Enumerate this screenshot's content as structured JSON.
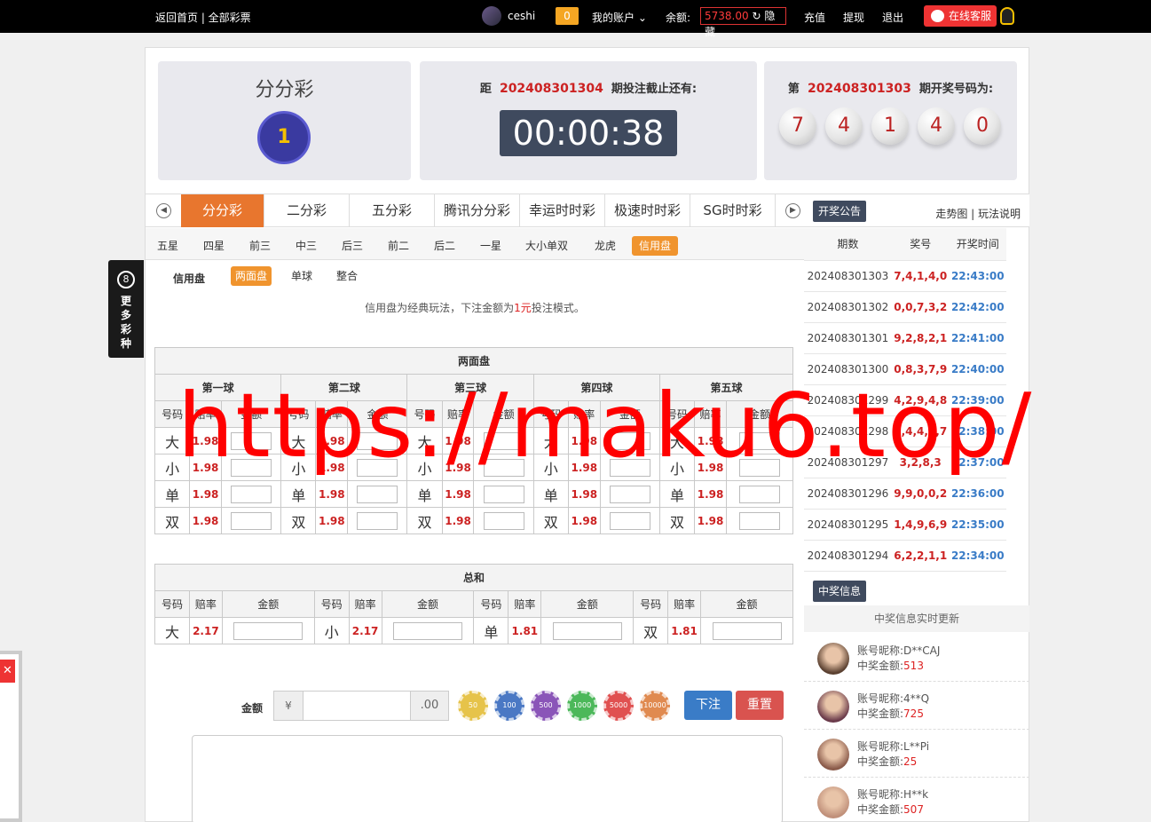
{
  "topbar": {
    "home_links": "返回首页 | 全部彩票",
    "username": "ceshi",
    "message_count": "0",
    "account_menu": "我的账户",
    "balance_label": "余额:",
    "balance_value": "5738.00",
    "balance_hide": "隐藏",
    "recharge": "充值",
    "withdraw": "提现",
    "logout": "退出",
    "service": "在线客服"
  },
  "game": {
    "title": "分分彩",
    "logo_text": "1"
  },
  "countdown": {
    "prefix": "距",
    "issue": "202408301304",
    "suffix": "期投注截止还有:",
    "time": "00:00:38"
  },
  "result": {
    "prefix": "第",
    "issue": "202408301303",
    "suffix": "期开奖号码为:",
    "balls": [
      "7",
      "4",
      "1",
      "4",
      "0"
    ]
  },
  "lottery_tabs": [
    "分分彩",
    "二分彩",
    "五分彩",
    "腾讯分分彩",
    "幸运时时彩",
    "极速时时彩",
    "SG时时彩"
  ],
  "play_tabs": [
    "五星",
    "四星",
    "前三",
    "中三",
    "后三",
    "前二",
    "后二",
    "一星",
    "大小单双",
    "龙虎",
    "信用盘"
  ],
  "mode": {
    "label": "信用盘",
    "options": [
      "两面盘",
      "单球",
      "整合"
    ],
    "description_pre": "信用盘为经典玩法，下注金额为",
    "description_red": "1元",
    "description_post": "投注模式。"
  },
  "two_sides": {
    "title": "两面盘",
    "balls": [
      "第一球",
      "第二球",
      "第三球",
      "第四球",
      "第五球"
    ],
    "headers": [
      "号码",
      "赔率",
      "金额"
    ],
    "rows": [
      {
        "code": "大",
        "odds": "1.98"
      },
      {
        "code": "小",
        "odds": "1.98"
      },
      {
        "code": "单",
        "odds": "1.98"
      },
      {
        "code": "双",
        "odds": "1.98"
      }
    ]
  },
  "sum": {
    "title": "总和",
    "headers": [
      "号码",
      "赔率",
      "金额"
    ],
    "items": [
      {
        "code": "大",
        "odds": "2.17"
      },
      {
        "code": "小",
        "odds": "2.17"
      },
      {
        "code": "单",
        "odds": "1.81"
      },
      {
        "code": "双",
        "odds": "1.81"
      }
    ]
  },
  "amount": {
    "label": "金额",
    "prefix": "¥",
    "suffix": ".00",
    "chips": [
      "50",
      "100",
      "500",
      "1000",
      "5000",
      "10000"
    ],
    "chip_colors": [
      "#e6c34a",
      "#4a78c4",
      "#8a55b8",
      "#4cb85a",
      "#e05050",
      "#e08a50"
    ],
    "submit": "下注",
    "reset": "重置"
  },
  "history": {
    "badge": "开奖公告",
    "links": "走势图 | 玩法说明",
    "headers": [
      "期数",
      "奖号",
      "开奖时间"
    ],
    "rows": [
      {
        "issue": "202408301303",
        "code": "7,4,1,4,0",
        "time": "22:43:00"
      },
      {
        "issue": "202408301302",
        "code": "0,0,7,3,2",
        "time": "22:42:00"
      },
      {
        "issue": "202408301301",
        "code": "9,2,8,2,1",
        "time": "22:41:00"
      },
      {
        "issue": "202408301300",
        "code": "0,8,3,7,9",
        "time": "22:40:00"
      },
      {
        "issue": "202408301299",
        "code": "4,2,9,4,8",
        "time": "22:39:00"
      },
      {
        "issue": "202408301298",
        "code": "3,4,4,4,7",
        "time": "22:38:00"
      },
      {
        "issue": "202408301297",
        "code": "3,2,8,3",
        "time": "22:37:00"
      },
      {
        "issue": "202408301296",
        "code": "9,9,0,0,2",
        "time": "22:36:00"
      },
      {
        "issue": "202408301295",
        "code": "1,4,9,6,9",
        "time": "22:35:00"
      },
      {
        "issue": "202408301294",
        "code": "6,2,2,1,1",
        "time": "22:34:00"
      }
    ]
  },
  "winners": {
    "badge": "中奖信息",
    "subtitle": "中奖信息实时更新",
    "name_label": "账号昵称:",
    "amount_label": "中奖金额:",
    "list": [
      {
        "name": "D**CAJ",
        "amount": "513"
      },
      {
        "name": "4**Q",
        "amount": "725"
      },
      {
        "name": "L**Pi",
        "amount": "25"
      },
      {
        "name": "H**k",
        "amount": "507"
      }
    ]
  },
  "side": {
    "more_icon": "8",
    "more_text": "更多彩种",
    "popup_close": "✕"
  },
  "watermark": "https://maku6.top/"
}
